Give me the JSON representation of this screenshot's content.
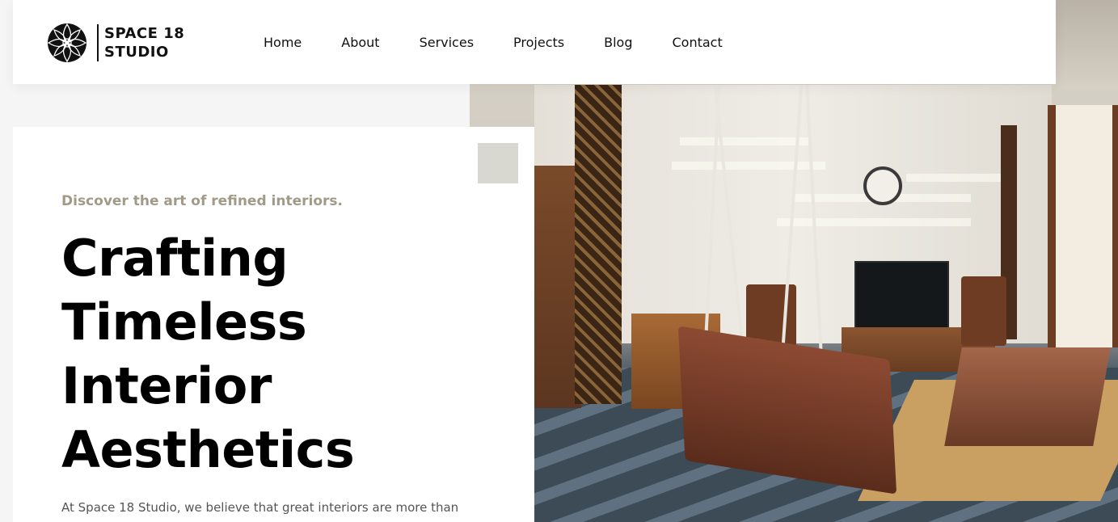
{
  "brand": {
    "line1": "SPACE 18",
    "line2": "STUDIO",
    "logo_icon": "lotus-mandala-icon"
  },
  "nav": {
    "items": [
      {
        "label": "Home"
      },
      {
        "label": "About"
      },
      {
        "label": "Services"
      },
      {
        "label": "Projects"
      },
      {
        "label": "Blog"
      },
      {
        "label": "Contact"
      }
    ]
  },
  "hero": {
    "eyebrow": "Discover the art of refined interiors.",
    "headline_lines": [
      "Crafting",
      "Timeless",
      "Interior",
      "Aesthetics"
    ],
    "intro": "At Space 18 Studio, we believe that great interiors are more than",
    "image_subject": "living-room-with-wooden-swing"
  },
  "colors": {
    "eyebrow": "#a09a86",
    "accent_square": "#d8d8d0",
    "headline": "#000000",
    "background": "#f5f5f5"
  }
}
